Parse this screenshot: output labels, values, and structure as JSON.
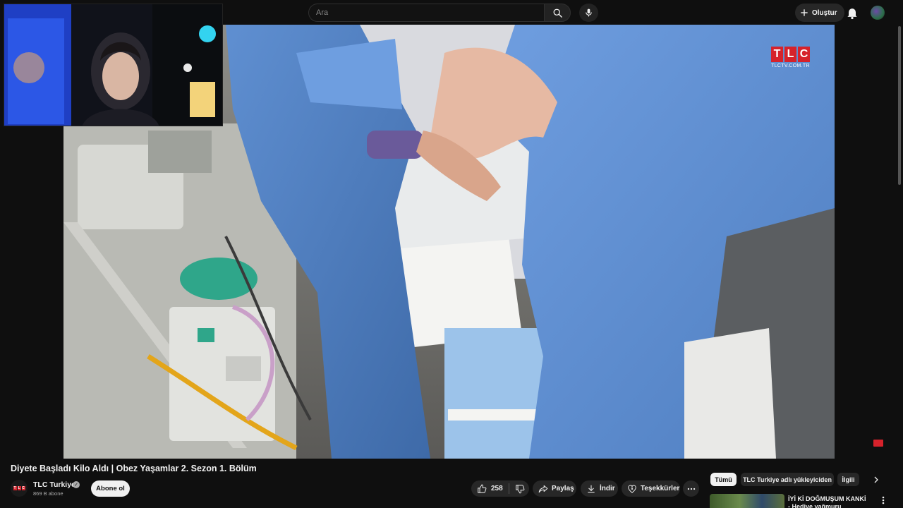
{
  "search": {
    "placeholder": "Ara"
  },
  "header": {
    "create_label": "Oluştur"
  },
  "video": {
    "title": "Diyete Başladı Kilo Aldı | Obez Yaşamlar 2. Sezon 1. Bölüm",
    "watermark_url": "TLCTV.COM.TR"
  },
  "channel": {
    "name": "TLC Turkiye",
    "subscribers": "869 B abone",
    "subscribe_label": "Abone ol"
  },
  "actions": {
    "likes": "258",
    "share_label": "Paylaş",
    "download_label": "İndir",
    "thanks_label": "Teşekkürler"
  },
  "chips": [
    "Tümü",
    "TLC Turkiye adlı yükleyiciden",
    "İlgili"
  ],
  "recommendation": {
    "title": "İYİ Kİ DOĞMUŞUM KANKİ - Hediye yağmuru"
  },
  "colors": {
    "brand_red": "#d6222b",
    "scrubs_blue": "#5f8fd1",
    "background": "#0f0f0f"
  },
  "icons": [
    "search-icon",
    "mic-icon",
    "plus-icon",
    "bell-icon",
    "like-icon",
    "dislike-icon",
    "share-icon",
    "download-icon",
    "thanks-icon",
    "more-icon",
    "chevron-right-icon",
    "kebab-icon"
  ]
}
